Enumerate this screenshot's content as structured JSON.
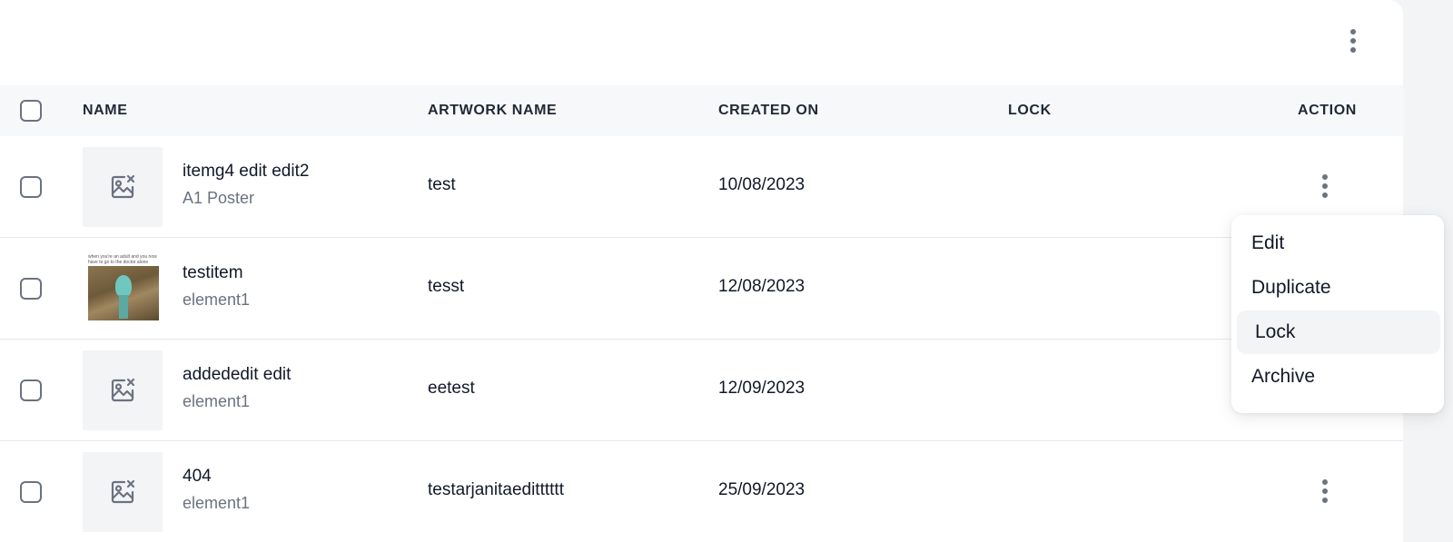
{
  "table": {
    "columns": {
      "name": "NAME",
      "artwork_name": "ARTWORK NAME",
      "created_on": "CREATED ON",
      "lock": "LOCK",
      "action": "ACTION"
    },
    "rows": [
      {
        "name": "itemg4 edit edit2",
        "subtitle": "A1 Poster",
        "artwork_name": "test",
        "created_on": "10/08/2023",
        "thumbnail": "image-placeholder-icon"
      },
      {
        "name": "testitem",
        "subtitle": "element1",
        "artwork_name": "tesst",
        "created_on": "12/08/2023",
        "thumbnail": "photo",
        "thumbnail_caption": "when you're an adult and you now have to go to the doctor alone"
      },
      {
        "name": "addededit edit",
        "subtitle": "element1",
        "artwork_name": "eetest",
        "created_on": "12/09/2023",
        "thumbnail": "image-placeholder-icon"
      },
      {
        "name": "404",
        "subtitle": "element1",
        "artwork_name": "testarjanitaeditttttt",
        "created_on": "25/09/2023",
        "thumbnail": "image-placeholder-icon"
      }
    ]
  },
  "action_menu": {
    "items": [
      "Edit",
      "Duplicate",
      "Lock",
      "Archive"
    ],
    "highlighted": "Lock"
  },
  "icons": {
    "header_menu": "more-vertical-icon",
    "row_action": "more-vertical-icon",
    "placeholder": "image-off-icon"
  }
}
